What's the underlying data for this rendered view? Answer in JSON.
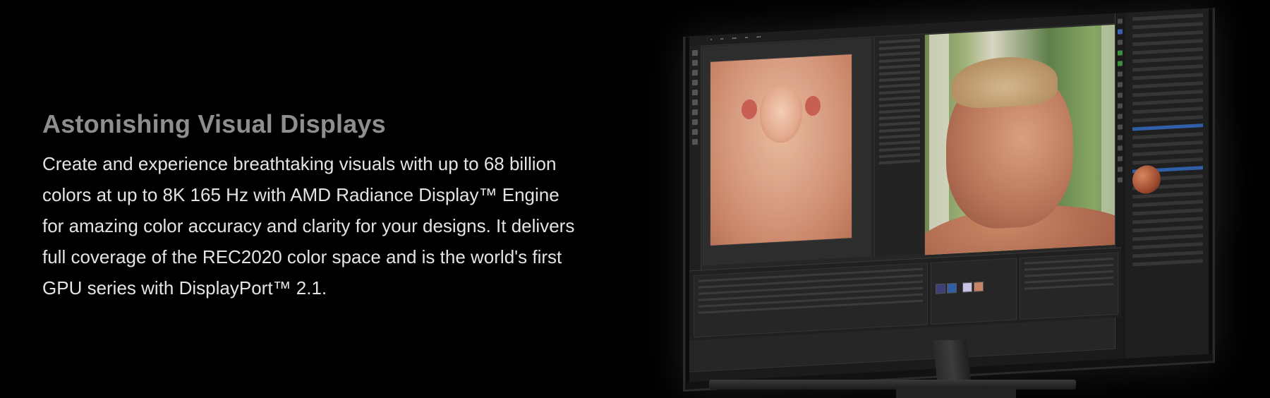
{
  "section": {
    "heading": "Astonishing Visual Displays",
    "body": "Create and experience breathtaking visuals with up to 68 billion colors at up to 8K 165 Hz with AMD Radiance Display™ Engine for amazing color accuracy and clarity for your designs. It delivers full coverage of the REC2020 color space and is the world's first GPU series with DisplayPort™ 2.1."
  },
  "colors": {
    "background": "#000000",
    "heading": "#8e8e8e",
    "body_text": "#e4e4e4",
    "app_ui": "#262626",
    "accent": "#2f5fa8"
  },
  "icons": [
    "monitor-stand-icon",
    "render-viewport-icon",
    "material-sphere-icon"
  ]
}
